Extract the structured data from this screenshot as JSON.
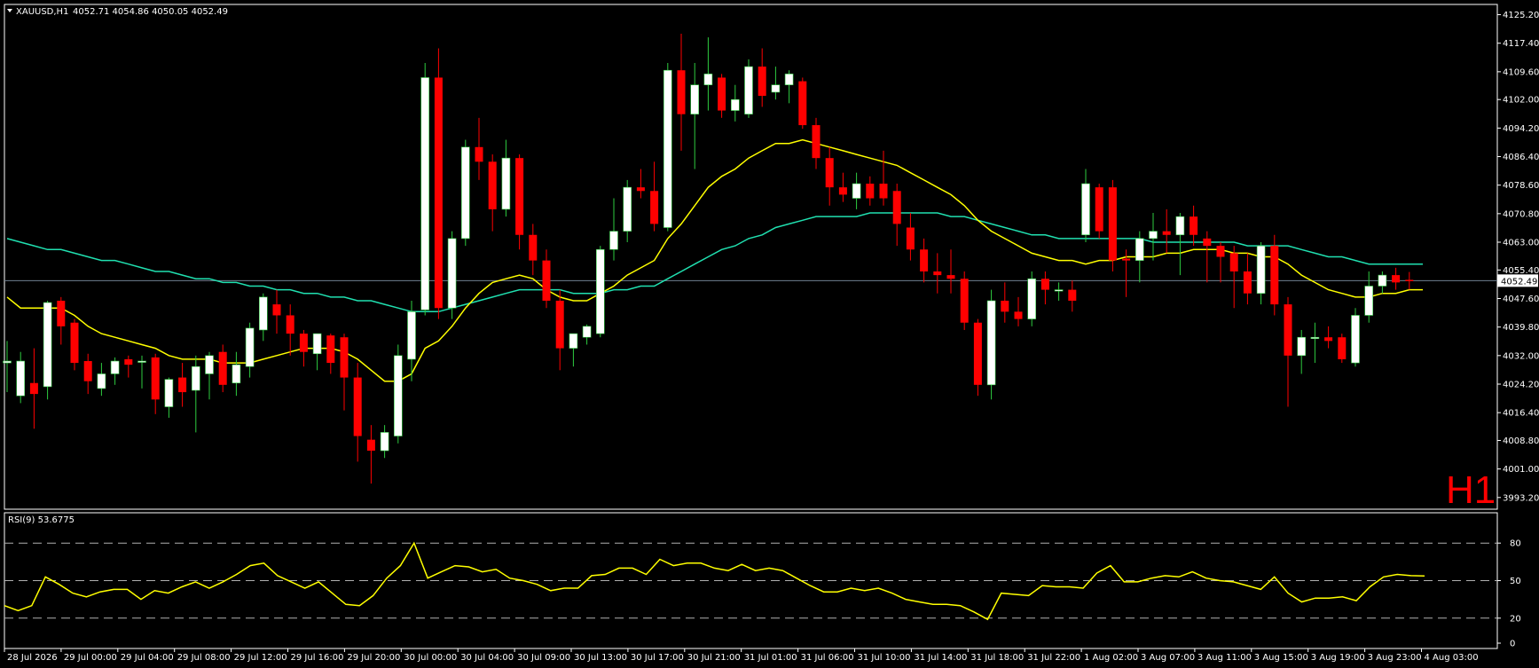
{
  "header": {
    "symbol": "XAUUSD,H1",
    "ohlc": "4052.71 4054.86 4050.05 4052.49"
  },
  "timeframe_label": "H1",
  "colors": {
    "background": "#000000",
    "frame": "#ffffff",
    "bull": "#ffffff",
    "bear": "#ff0000",
    "ma_fast": "#ffff00",
    "ma_slow": "#20e0b0",
    "rsi": "#ffff00",
    "price_line": "#6e7f8f"
  },
  "chart_data": [
    {
      "type": "candlestick",
      "title": "XAUUSD,H1",
      "ylim": [
        3990.0,
        4128.0
      ],
      "y_ticks": [
        "4125.20",
        "4117.40",
        "4109.60",
        "4102.00",
        "4094.20",
        "4086.40",
        "4078.60",
        "4070.80",
        "4063.00",
        "4055.40",
        "4047.60",
        "4039.80",
        "4032.00",
        "4024.20",
        "4016.40",
        "4008.80",
        "4001.00",
        "3993.20"
      ],
      "x_tick_labels": [
        "28 Jul 2026",
        "29 Jul 00:00",
        "29 Jul 04:00",
        "29 Jul 08:00",
        "29 Jul 12:00",
        "29 Jul 16:00",
        "29 Jul 20:00",
        "30 Jul 00:00",
        "30 Jul 04:00",
        "30 Jul 09:00",
        "30 Jul 13:00",
        "30 Jul 17:00",
        "30 Jul 21:00",
        "31 Jul 01:00",
        "31 Jul 06:00",
        "31 Jul 10:00",
        "31 Jul 14:00",
        "31 Jul 18:00",
        "31 Jul 22:00",
        "1 Aug 02:00",
        "3 Aug 07:00",
        "3 Aug 11:00",
        "3 Aug 15:00",
        "3 Aug 19:00",
        "3 Aug 23:00",
        "4 Aug 03:00"
      ],
      "current_price": 4052.49,
      "current_price_label": "4052.49",
      "candles": [
        {
          "o": 4030.0,
          "h": 4036.0,
          "l": 4022.0,
          "c": 4030.5
        },
        {
          "o": 4021.0,
          "h": 4033.0,
          "l": 4019.0,
          "c": 4030.5
        },
        {
          "o": 4024.5,
          "h": 4034.0,
          "l": 4012.0,
          "c": 4021.5
        },
        {
          "o": 4023.5,
          "h": 4047.0,
          "l": 4020.0,
          "c": 4046.5
        },
        {
          "o": 4047.0,
          "h": 4048.0,
          "l": 4035.0,
          "c": 4040.0
        },
        {
          "o": 4041.0,
          "h": 4042.0,
          "l": 4028.0,
          "c": 4030.0
        },
        {
          "o": 4030.5,
          "h": 4032.5,
          "l": 4021.5,
          "c": 4025.0
        },
        {
          "o": 4023.0,
          "h": 4030.0,
          "l": 4021.0,
          "c": 4027.0
        },
        {
          "o": 4027.0,
          "h": 4031.5,
          "l": 4024.0,
          "c": 4030.5
        },
        {
          "o": 4031.0,
          "h": 4032.0,
          "l": 4026.0,
          "c": 4029.5
        },
        {
          "o": 4030.5,
          "h": 4032.0,
          "l": 4023.0,
          "c": 4030.5
        },
        {
          "o": 4031.5,
          "h": 4032.5,
          "l": 4016.0,
          "c": 4020.0
        },
        {
          "o": 4018.0,
          "h": 4026.0,
          "l": 4015.0,
          "c": 4025.5
        },
        {
          "o": 4026.0,
          "h": 4030.0,
          "l": 4018.0,
          "c": 4022.0
        },
        {
          "o": 4022.5,
          "h": 4032.0,
          "l": 4011.0,
          "c": 4029.0
        },
        {
          "o": 4027.0,
          "h": 4033.0,
          "l": 4020.0,
          "c": 4032.0
        },
        {
          "o": 4033.0,
          "h": 4035.0,
          "l": 4022.0,
          "c": 4024.0
        },
        {
          "o": 4024.5,
          "h": 4033.0,
          "l": 4021.0,
          "c": 4029.5
        },
        {
          "o": 4029.0,
          "h": 4041.0,
          "l": 4026.0,
          "c": 4039.5
        },
        {
          "o": 4039.0,
          "h": 4049.0,
          "l": 4036.0,
          "c": 4048.0
        },
        {
          "o": 4046.0,
          "h": 4050.0,
          "l": 4038.0,
          "c": 4043.0
        },
        {
          "o": 4043.0,
          "h": 4046.0,
          "l": 4032.0,
          "c": 4038.0
        },
        {
          "o": 4038.0,
          "h": 4039.0,
          "l": 4029.0,
          "c": 4033.0
        },
        {
          "o": 4032.5,
          "h": 4037.0,
          "l": 4028.0,
          "c": 4038.0
        },
        {
          "o": 4037.5,
          "h": 4038.0,
          "l": 4027.0,
          "c": 4030.0
        },
        {
          "o": 4037.0,
          "h": 4038.0,
          "l": 4017.0,
          "c": 4026.0
        },
        {
          "o": 4026.0,
          "h": 4030.0,
          "l": 4003.0,
          "c": 4010.0
        },
        {
          "o": 4009.0,
          "h": 4013.0,
          "l": 3997.0,
          "c": 4006.0
        },
        {
          "o": 4006.0,
          "h": 4013.0,
          "l": 4004.0,
          "c": 4011.0
        },
        {
          "o": 4010.0,
          "h": 4035.0,
          "l": 4008.0,
          "c": 4032.0
        },
        {
          "o": 4031.0,
          "h": 4047.0,
          "l": 4025.0,
          "c": 4044.0
        },
        {
          "o": 4044.5,
          "h": 4112.0,
          "l": 4043.0,
          "c": 4108.0
        },
        {
          "o": 4108.0,
          "h": 4116.0,
          "l": 4042.0,
          "c": 4045.0
        },
        {
          "o": 4045.0,
          "h": 4066.0,
          "l": 4042.0,
          "c": 4064.0
        },
        {
          "o": 4064.0,
          "h": 4091.0,
          "l": 4062.0,
          "c": 4089.0
        },
        {
          "o": 4089.0,
          "h": 4097.0,
          "l": 4080.0,
          "c": 4085.0
        },
        {
          "o": 4085.0,
          "h": 4087.0,
          "l": 4066.0,
          "c": 4072.0
        },
        {
          "o": 4072.0,
          "h": 4091.0,
          "l": 4070.0,
          "c": 4086.0
        },
        {
          "o": 4086.0,
          "h": 4087.0,
          "l": 4061.0,
          "c": 4065.0
        },
        {
          "o": 4065.0,
          "h": 4068.0,
          "l": 4054.0,
          "c": 4058.0
        },
        {
          "o": 4058.0,
          "h": 4061.0,
          "l": 4045.0,
          "c": 4047.0
        },
        {
          "o": 4047.0,
          "h": 4050.0,
          "l": 4028.0,
          "c": 4034.0
        },
        {
          "o": 4034.0,
          "h": 4038.0,
          "l": 4029.0,
          "c": 4038.0
        },
        {
          "o": 4037.0,
          "h": 4040.5,
          "l": 4035.0,
          "c": 4040.0
        },
        {
          "o": 4038.0,
          "h": 4062.0,
          "l": 4037.0,
          "c": 4061.0
        },
        {
          "o": 4061.0,
          "h": 4075.0,
          "l": 4058.0,
          "c": 4066.0
        },
        {
          "o": 4066.0,
          "h": 4080.0,
          "l": 4063.0,
          "c": 4078.0
        },
        {
          "o": 4078.0,
          "h": 4083.0,
          "l": 4075.0,
          "c": 4077.0
        },
        {
          "o": 4077.0,
          "h": 4085.0,
          "l": 4066.0,
          "c": 4068.0
        },
        {
          "o": 4067.0,
          "h": 4112.0,
          "l": 4066.0,
          "c": 4110.0
        },
        {
          "o": 4110.0,
          "h": 4120.0,
          "l": 4088.0,
          "c": 4098.0
        },
        {
          "o": 4098.0,
          "h": 4112.0,
          "l": 4083.0,
          "c": 4106.0
        },
        {
          "o": 4106.0,
          "h": 4119.0,
          "l": 4099.0,
          "c": 4109.0
        },
        {
          "o": 4108.0,
          "h": 4109.0,
          "l": 4097.0,
          "c": 4099.0
        },
        {
          "o": 4099.0,
          "h": 4106.0,
          "l": 4096.0,
          "c": 4102.0
        },
        {
          "o": 4098.0,
          "h": 4113.0,
          "l": 4097.0,
          "c": 4111.0
        },
        {
          "o": 4111.0,
          "h": 4116.0,
          "l": 4100.0,
          "c": 4103.0
        },
        {
          "o": 4104.0,
          "h": 4111.0,
          "l": 4102.0,
          "c": 4106.0
        },
        {
          "o": 4106.0,
          "h": 4110.0,
          "l": 4101.0,
          "c": 4109.0
        },
        {
          "o": 4107.0,
          "h": 4108.0,
          "l": 4094.0,
          "c": 4095.0
        },
        {
          "o": 4095.0,
          "h": 4097.0,
          "l": 4083.0,
          "c": 4086.0
        },
        {
          "o": 4086.0,
          "h": 4089.0,
          "l": 4073.0,
          "c": 4078.0
        },
        {
          "o": 4078.0,
          "h": 4082.0,
          "l": 4074.0,
          "c": 4076.0
        },
        {
          "o": 4075.0,
          "h": 4082.0,
          "l": 4072.0,
          "c": 4079.0
        },
        {
          "o": 4079.0,
          "h": 4081.0,
          "l": 4073.0,
          "c": 4075.0
        },
        {
          "o": 4079.0,
          "h": 4088.0,
          "l": 4073.0,
          "c": 4075.0
        },
        {
          "o": 4077.0,
          "h": 4079.0,
          "l": 4062.0,
          "c": 4068.0
        },
        {
          "o": 4067.0,
          "h": 4071.0,
          "l": 4058.0,
          "c": 4061.0
        },
        {
          "o": 4061.0,
          "h": 4064.0,
          "l": 4052.0,
          "c": 4055.0
        },
        {
          "o": 4055.0,
          "h": 4060.0,
          "l": 4049.0,
          "c": 4054.0
        },
        {
          "o": 4054.0,
          "h": 4061.0,
          "l": 4049.0,
          "c": 4053.0
        },
        {
          "o": 4053.0,
          "h": 4055.0,
          "l": 4039.0,
          "c": 4041.0
        },
        {
          "o": 4041.0,
          "h": 4042.0,
          "l": 4021.0,
          "c": 4024.0
        },
        {
          "o": 4024.0,
          "h": 4050.0,
          "l": 4020.0,
          "c": 4047.0
        },
        {
          "o": 4047.0,
          "h": 4052.0,
          "l": 4041.0,
          "c": 4044.0
        },
        {
          "o": 4044.0,
          "h": 4048.0,
          "l": 4040.0,
          "c": 4042.0
        },
        {
          "o": 4042.0,
          "h": 4055.0,
          "l": 4040.0,
          "c": 4053.0
        },
        {
          "o": 4053.0,
          "h": 4055.0,
          "l": 4046.0,
          "c": 4050.0
        },
        {
          "o": 4050.0,
          "h": 4052.0,
          "l": 4047.0,
          "c": 4050.0
        },
        {
          "o": 4050.0,
          "h": 4052.5,
          "l": 4044.0,
          "c": 4047.0
        },
        {
          "o": 4065.0,
          "h": 4083.0,
          "l": 4063.0,
          "c": 4079.0
        },
        {
          "o": 4078.0,
          "h": 4079.0,
          "l": 4064.0,
          "c": 4066.0
        },
        {
          "o": 4078.0,
          "h": 4080.0,
          "l": 4055.0,
          "c": 4058.0
        },
        {
          "o": 4058.5,
          "h": 4061.0,
          "l": 4048.0,
          "c": 4058.0
        },
        {
          "o": 4058.0,
          "h": 4066.0,
          "l": 4052.0,
          "c": 4064.0
        },
        {
          "o": 4064.0,
          "h": 4071.0,
          "l": 4058.0,
          "c": 4066.0
        },
        {
          "o": 4066.0,
          "h": 4072.0,
          "l": 4060.0,
          "c": 4065.0
        },
        {
          "o": 4065.0,
          "h": 4071.0,
          "l": 4054.0,
          "c": 4070.0
        },
        {
          "o": 4070.0,
          "h": 4073.0,
          "l": 4062.0,
          "c": 4065.0
        },
        {
          "o": 4064.0,
          "h": 4066.0,
          "l": 4052.0,
          "c": 4062.0
        },
        {
          "o": 4062.0,
          "h": 4063.0,
          "l": 4052.0,
          "c": 4059.0
        },
        {
          "o": 4060.0,
          "h": 4062.0,
          "l": 4045.0,
          "c": 4055.0
        },
        {
          "o": 4055.0,
          "h": 4060.0,
          "l": 4046.0,
          "c": 4049.0
        },
        {
          "o": 4049.0,
          "h": 4063.0,
          "l": 4046.0,
          "c": 4062.0
        },
        {
          "o": 4062.0,
          "h": 4065.0,
          "l": 4043.0,
          "c": 4046.0
        },
        {
          "o": 4046.0,
          "h": 4048.0,
          "l": 4018.0,
          "c": 4032.0
        },
        {
          "o": 4032.0,
          "h": 4039.0,
          "l": 4027.0,
          "c": 4037.0
        },
        {
          "o": 4037.0,
          "h": 4041.0,
          "l": 4030.0,
          "c": 4037.0
        },
        {
          "o": 4037.0,
          "h": 4040.0,
          "l": 4034.0,
          "c": 4036.0
        },
        {
          "o": 4037.0,
          "h": 4038.0,
          "l": 4030.0,
          "c": 4031.0
        },
        {
          "o": 4030.0,
          "h": 4045.0,
          "l": 4029.0,
          "c": 4043.0
        },
        {
          "o": 4043.0,
          "h": 4055.0,
          "l": 4041.0,
          "c": 4051.0
        },
        {
          "o": 4051.0,
          "h": 4055.0,
          "l": 4049.0,
          "c": 4054.0
        },
        {
          "o": 4054.0,
          "h": 4056.0,
          "l": 4050.0,
          "c": 4052.0
        },
        {
          "o": 4052.71,
          "h": 4054.86,
          "l": 4050.05,
          "c": 4052.49
        }
      ],
      "ma_fast": [
        4048,
        4045,
        4045,
        4045,
        4045,
        4043,
        4040,
        4038,
        4037,
        4036,
        4035,
        4034,
        4032,
        4031,
        4031,
        4031,
        4030,
        4030,
        4030,
        4031,
        4032,
        4033,
        4034,
        4034,
        4034,
        4033,
        4031,
        4028,
        4025,
        4025,
        4027,
        4034,
        4036,
        4040,
        4045,
        4049,
        4052,
        4053,
        4054,
        4053,
        4050,
        4048,
        4047,
        4047,
        4049,
        4051,
        4054,
        4056,
        4058,
        4064,
        4068,
        4073,
        4078,
        4081,
        4083,
        4086,
        4088,
        4090,
        4090,
        4091,
        4090,
        4089,
        4088,
        4087,
        4086,
        4085,
        4084,
        4082,
        4080,
        4078,
        4076,
        4073,
        4069,
        4066,
        4064,
        4062,
        4060,
        4059,
        4058,
        4058,
        4057,
        4058,
        4058,
        4059,
        4059,
        4059,
        4060,
        4060,
        4061,
        4061,
        4061,
        4060,
        4060,
        4059,
        4059,
        4057,
        4054,
        4052,
        4050,
        4049,
        4048,
        4048,
        4049,
        4049,
        4050,
        4050
      ],
      "ma_slow": [
        4064,
        4063,
        4062,
        4061,
        4061,
        4060,
        4059,
        4058,
        4058,
        4057,
        4056,
        4055,
        4055,
        4054,
        4053,
        4053,
        4052,
        4052,
        4051,
        4051,
        4050,
        4050,
        4049,
        4049,
        4048,
        4048,
        4047,
        4047,
        4046,
        4045,
        4044,
        4044,
        4044,
        4045,
        4046,
        4047,
        4048,
        4049,
        4050,
        4050,
        4050,
        4050,
        4049,
        4049,
        4049,
        4050,
        4050,
        4051,
        4051,
        4053,
        4055,
        4057,
        4059,
        4061,
        4062,
        4064,
        4065,
        4067,
        4068,
        4069,
        4070,
        4070,
        4070,
        4070,
        4071,
        4071,
        4071,
        4071,
        4071,
        4071,
        4070,
        4070,
        4069,
        4068,
        4067,
        4066,
        4065,
        4065,
        4064,
        4064,
        4064,
        4064,
        4064,
        4064,
        4064,
        4063,
        4063,
        4063,
        4063,
        4063,
        4063,
        4063,
        4062,
        4062,
        4062,
        4062,
        4061,
        4060,
        4059,
        4059,
        4058,
        4057,
        4057,
        4057,
        4057,
        4057
      ]
    },
    {
      "type": "line",
      "title": "RSI(9) 53.6775",
      "ylim": [
        0,
        100
      ],
      "y_ticks": [
        "80",
        "50",
        "20",
        "0"
      ],
      "levels": [
        80,
        50,
        20
      ],
      "values": [
        30,
        26,
        30,
        53,
        47,
        40,
        37,
        41,
        43,
        43,
        35,
        42,
        40,
        45,
        49,
        44,
        49,
        55,
        62,
        64,
        54,
        49,
        44,
        49,
        40,
        31,
        30,
        38,
        52,
        62,
        80,
        52,
        57,
        62,
        61,
        57,
        59,
        52,
        50,
        47,
        42,
        44,
        44,
        54,
        55,
        60,
        60,
        55,
        67,
        62,
        64,
        64,
        60,
        58,
        63,
        58,
        60,
        58,
        52,
        46,
        41,
        41,
        44,
        42,
        44,
        40,
        35,
        33,
        31,
        31,
        30,
        25,
        19,
        40,
        39,
        38,
        46,
        45,
        45,
        44,
        56,
        62,
        49,
        49,
        52,
        54,
        53,
        57,
        52,
        50,
        49,
        46,
        43,
        53,
        40,
        33,
        36,
        36,
        37,
        34,
        45,
        53,
        55,
        54,
        53.7
      ]
    }
  ]
}
